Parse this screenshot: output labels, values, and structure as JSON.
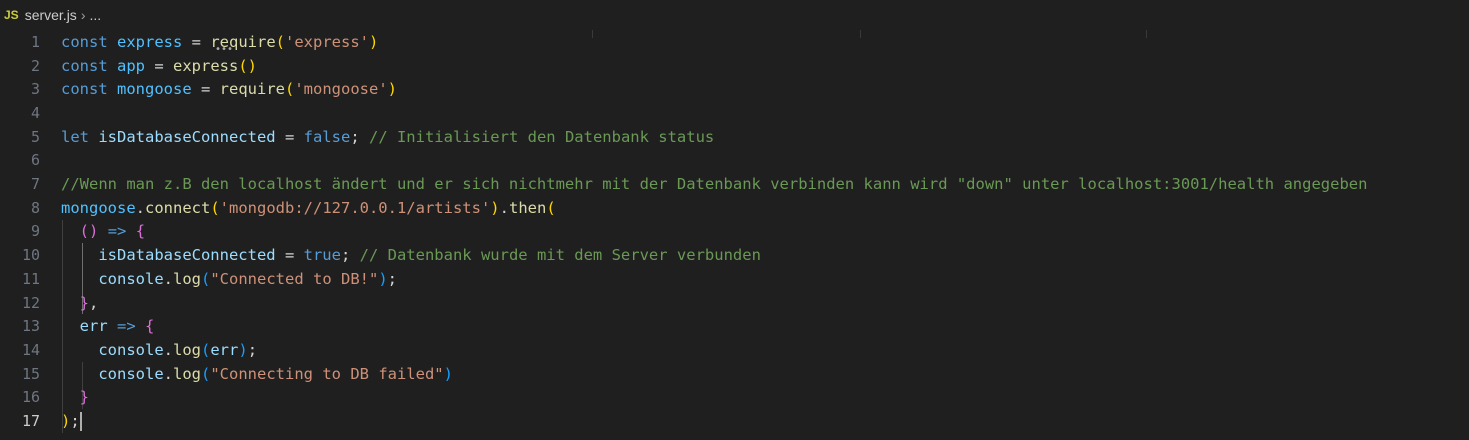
{
  "breadcrumb": {
    "lang_badge": "JS",
    "file": "server.js",
    "separator": "›",
    "ellipsis": "..."
  },
  "editor": {
    "active_line": 17,
    "lines": [
      {
        "n": "1",
        "tokens": [
          [
            "kw",
            "const "
          ],
          [
            "cst",
            "express"
          ],
          [
            "op",
            " = "
          ],
          [
            "fn",
            "require"
          ],
          [
            "br1",
            "("
          ],
          [
            "str",
            "'express'"
          ],
          [
            "br1",
            ")"
          ]
        ]
      },
      {
        "n": "2",
        "tokens": [
          [
            "kw",
            "const "
          ],
          [
            "cst",
            "app"
          ],
          [
            "op",
            " = "
          ],
          [
            "fn",
            "express"
          ],
          [
            "br1",
            "()"
          ]
        ]
      },
      {
        "n": "3",
        "tokens": [
          [
            "kw",
            "const "
          ],
          [
            "cst",
            "mongoose"
          ],
          [
            "op",
            " = "
          ],
          [
            "fn",
            "require"
          ],
          [
            "br1",
            "("
          ],
          [
            "str",
            "'mongoose'"
          ],
          [
            "br1",
            ")"
          ]
        ]
      },
      {
        "n": "4",
        "tokens": []
      },
      {
        "n": "5",
        "tokens": [
          [
            "kw",
            "let "
          ],
          [
            "var",
            "isDatabaseConnected"
          ],
          [
            "op",
            " = "
          ],
          [
            "kw",
            "false"
          ],
          [
            "op",
            "; "
          ],
          [
            "cm",
            "// Initialisiert den Datenbank status"
          ]
        ]
      },
      {
        "n": "6",
        "tokens": []
      },
      {
        "n": "7",
        "tokens": [
          [
            "cm",
            "//Wenn man z.B den localhost ändert und er sich nichtmehr mit der Datenbank verbinden kann wird \"down\" unter localhost:3001/health angegeben"
          ]
        ]
      },
      {
        "n": "8",
        "tokens": [
          [
            "cst",
            "mongoose"
          ],
          [
            "op",
            "."
          ],
          [
            "fn",
            "connect"
          ],
          [
            "br1",
            "("
          ],
          [
            "str",
            "'mongodb://127.0.0.1/artists'"
          ],
          [
            "br1",
            ")"
          ],
          [
            "op",
            "."
          ],
          [
            "fn",
            "then"
          ],
          [
            "br1",
            "("
          ]
        ]
      },
      {
        "n": "9",
        "tokens": [
          [
            "op",
            "  "
          ],
          [
            "br2",
            "()"
          ],
          [
            "op",
            " "
          ],
          [
            "kw",
            "=>"
          ],
          [
            "op",
            " "
          ],
          [
            "br2",
            "{"
          ]
        ]
      },
      {
        "n": "10",
        "tokens": [
          [
            "op",
            "    "
          ],
          [
            "var",
            "isDatabaseConnected"
          ],
          [
            "op",
            " = "
          ],
          [
            "kw",
            "true"
          ],
          [
            "op",
            "; "
          ],
          [
            "cm",
            "// Datenbank wurde mit dem Server verbunden"
          ]
        ]
      },
      {
        "n": "11",
        "tokens": [
          [
            "op",
            "    "
          ],
          [
            "var",
            "console"
          ],
          [
            "op",
            "."
          ],
          [
            "fn",
            "log"
          ],
          [
            "br3",
            "("
          ],
          [
            "str",
            "\"Connected to DB!\""
          ],
          [
            "br3",
            ")"
          ],
          [
            "op",
            ";"
          ]
        ]
      },
      {
        "n": "12",
        "tokens": [
          [
            "op",
            "  "
          ],
          [
            "br2",
            "}"
          ],
          [
            "op",
            ","
          ]
        ]
      },
      {
        "n": "13",
        "tokens": [
          [
            "op",
            "  "
          ],
          [
            "var",
            "err"
          ],
          [
            "op",
            " "
          ],
          [
            "kw",
            "=>"
          ],
          [
            "op",
            " "
          ],
          [
            "br2",
            "{"
          ]
        ]
      },
      {
        "n": "14",
        "tokens": [
          [
            "op",
            "    "
          ],
          [
            "var",
            "console"
          ],
          [
            "op",
            "."
          ],
          [
            "fn",
            "log"
          ],
          [
            "br3",
            "("
          ],
          [
            "var",
            "err"
          ],
          [
            "br3",
            ")"
          ],
          [
            "op",
            ";"
          ]
        ]
      },
      {
        "n": "15",
        "tokens": [
          [
            "op",
            "    "
          ],
          [
            "var",
            "console"
          ],
          [
            "op",
            "."
          ],
          [
            "fn",
            "log"
          ],
          [
            "br3",
            "("
          ],
          [
            "str",
            "\"Connecting to DB failed\""
          ],
          [
            "br3",
            ")"
          ]
        ]
      },
      {
        "n": "16",
        "tokens": [
          [
            "op",
            "  "
          ],
          [
            "br2",
            "}"
          ]
        ]
      },
      {
        "n": "17",
        "tokens": [
          [
            "br1",
            ")"
          ],
          [
            "op",
            ";"
          ]
        ]
      }
    ]
  }
}
